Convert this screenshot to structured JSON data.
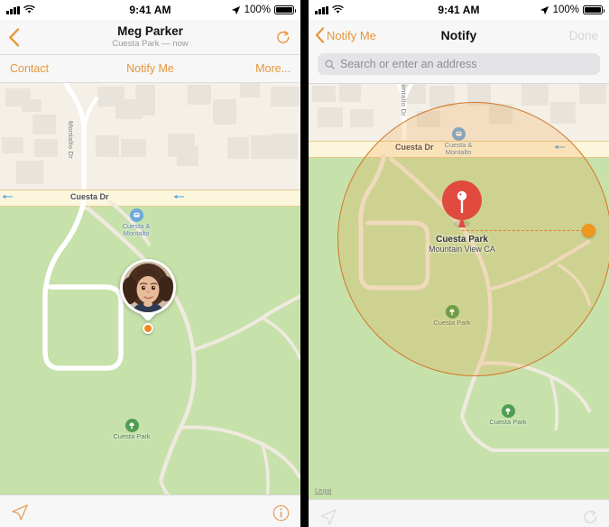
{
  "left": {
    "status_bar": {
      "time": "9:41 AM",
      "battery_percent": "100%",
      "signal_icon": "cellular-bars-icon",
      "wifi_icon": "wifi-icon",
      "location_icon": "location-arrow-icon",
      "battery_icon": "battery-full-icon"
    },
    "nav": {
      "back_icon": "chevron-left-icon",
      "title": "Meg Parker",
      "subtitle": "Cuesta Park — now",
      "refresh_icon": "refresh-icon"
    },
    "tabs": [
      {
        "label": "Contact",
        "name": "tab-contact"
      },
      {
        "label": "Notify Me",
        "name": "tab-notify-me"
      },
      {
        "label": "More...",
        "name": "tab-more"
      }
    ],
    "map": {
      "street_vertical": "Montalto Dr",
      "street_main": "Cuesta Dr",
      "transit_stop": "Cuesta &\nMontalto",
      "transit_stop_line1": "Cuesta &",
      "transit_stop_line2": "Montalto",
      "park_label": "Cuesta Park",
      "avatar_name": "Meg Parker avatar",
      "marker_color": "#f08a1e"
    },
    "bottom_bar": {
      "locate_icon": "location-arrow-outline-icon",
      "info_icon": "info-circle-icon"
    }
  },
  "right": {
    "status_bar": {
      "time": "9:41 AM",
      "battery_percent": "100%",
      "signal_icon": "cellular-bars-icon",
      "wifi_icon": "wifi-icon",
      "location_icon": "location-arrow-icon",
      "battery_icon": "battery-full-icon"
    },
    "nav": {
      "back_icon": "chevron-left-icon",
      "back_label": "Notify Me",
      "title": "Notify",
      "done_label": "Done",
      "done_enabled": false
    },
    "search": {
      "placeholder": "Search or enter an address",
      "icon": "search-icon",
      "value": ""
    },
    "map": {
      "street_vertical": "Montalto Dr",
      "street_main": "Cuesta Dr",
      "transit_stop_line1": "Cuesta &",
      "transit_stop_line2": "Montalto",
      "park_label": "Cuesta Park",
      "park_label_bottom": "Cuesta Park",
      "pin_title": "Cuesta Park",
      "pin_subtitle": "Mountain View CA",
      "legal_label": "Legal",
      "geofence_color": "#d2782a",
      "geofence_fill": "rgba(240,150,40,0.20)",
      "pin_color": "#e04a3f",
      "handle_color": "#f1961f"
    },
    "bottom_bar": {
      "locate_icon": "location-arrow-outline-icon",
      "refresh_icon": "refresh-icon"
    }
  },
  "theme": {
    "accent": "#e8963c",
    "park_green": "#c6e1aa",
    "land": "#f4f0e8",
    "road_yellow": "#fcf6dc"
  }
}
